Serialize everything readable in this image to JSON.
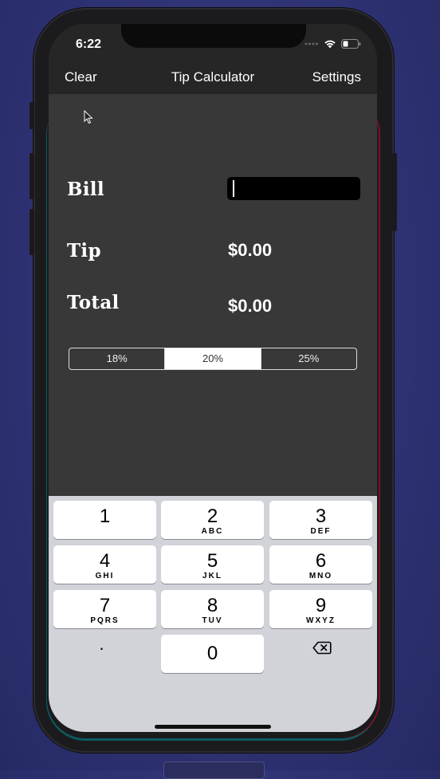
{
  "status_bar": {
    "time": "6:22"
  },
  "nav": {
    "left": "Clear",
    "title": "Tip Calculator",
    "right": "Settings"
  },
  "form": {
    "bill_label": "Bill",
    "bill_value": "",
    "tip_label": "Tip",
    "tip_amount": "$0.00",
    "total_label": "Total",
    "total_amount": "$0.00"
  },
  "tip_options": [
    "18%",
    "20%",
    "25%"
  ],
  "tip_selected": "20%",
  "keyboard": {
    "keys": [
      {
        "num": "1",
        "letters": ""
      },
      {
        "num": "2",
        "letters": "ABC"
      },
      {
        "num": "3",
        "letters": "DEF"
      },
      {
        "num": "4",
        "letters": "GHI"
      },
      {
        "num": "5",
        "letters": "JKL"
      },
      {
        "num": "6",
        "letters": "MNO"
      },
      {
        "num": "7",
        "letters": "PQRS"
      },
      {
        "num": "8",
        "letters": "TUV"
      },
      {
        "num": "9",
        "letters": "WXYZ"
      }
    ],
    "dot": ".",
    "zero": "0",
    "delete_icon": "backspace-icon"
  }
}
